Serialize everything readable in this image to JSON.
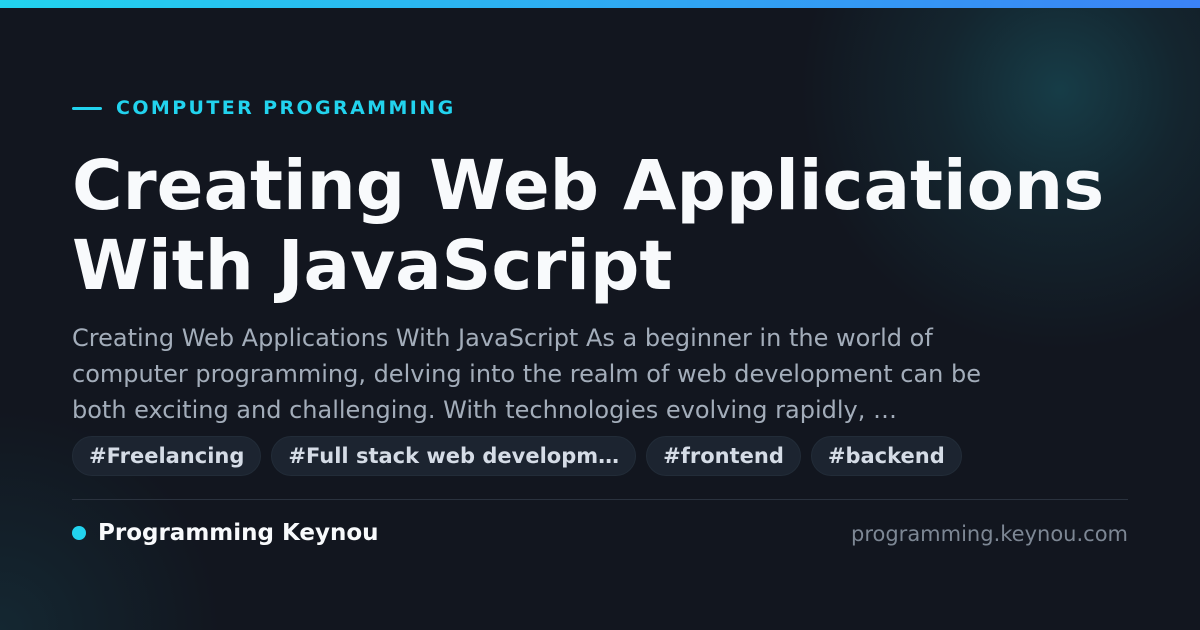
{
  "colors": {
    "accent": "#22d3ee",
    "accent_gradient_end": "#3b82f6",
    "background": "#12161f",
    "title": "#f8fafc",
    "body_text": "#a3adba",
    "tag_background": "#1c2430",
    "muted": "#7d8794"
  },
  "category": "COMPUTER PROGRAMMING",
  "title_lines": [
    "Creating Web Applications",
    "With JavaScript"
  ],
  "excerpt_lines": [
    "Creating Web Applications With JavaScript As a beginner in the world of",
    "computer programming, delving into the realm of web development can be",
    "both exciting and challenging. With technologies evolving rapidly, …"
  ],
  "tags": [
    "#Freelancing",
    "#Full stack web developm…",
    "#frontend",
    "#backend"
  ],
  "footer": {
    "brand": "Programming Keynou",
    "domain": "programming.keynou.com"
  }
}
